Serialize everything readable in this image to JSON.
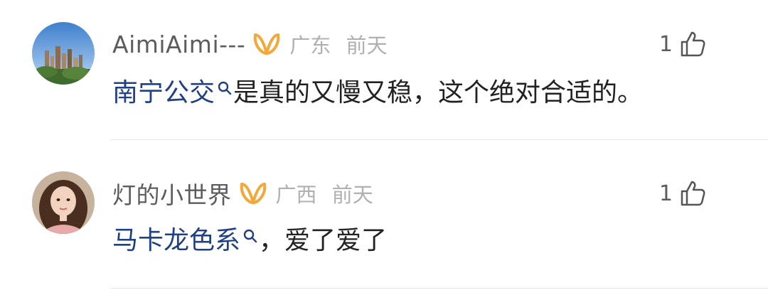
{
  "comments": [
    {
      "username": "AimiAimi---",
      "badge_icon": "gold-vip-badge-icon",
      "location": "广东",
      "time": "前天",
      "likes": "1",
      "topic": "南宁公交",
      "text": "是真的又慢又稳，这个绝对合适的。",
      "avatar_icon": "city-skyline-avatar"
    },
    {
      "username": "灯的小世界",
      "badge_icon": "gold-vip-badge-icon",
      "location": "广西",
      "time": "前天",
      "likes": "1",
      "topic": "马卡龙色系",
      "text": "，爱了爱了",
      "avatar_icon": "portrait-avatar"
    }
  ],
  "colors": {
    "topic_link": "#1f3f86",
    "badge": "#f4a83a",
    "meta": "#b0b0b0",
    "username": "#5c5c5c"
  }
}
